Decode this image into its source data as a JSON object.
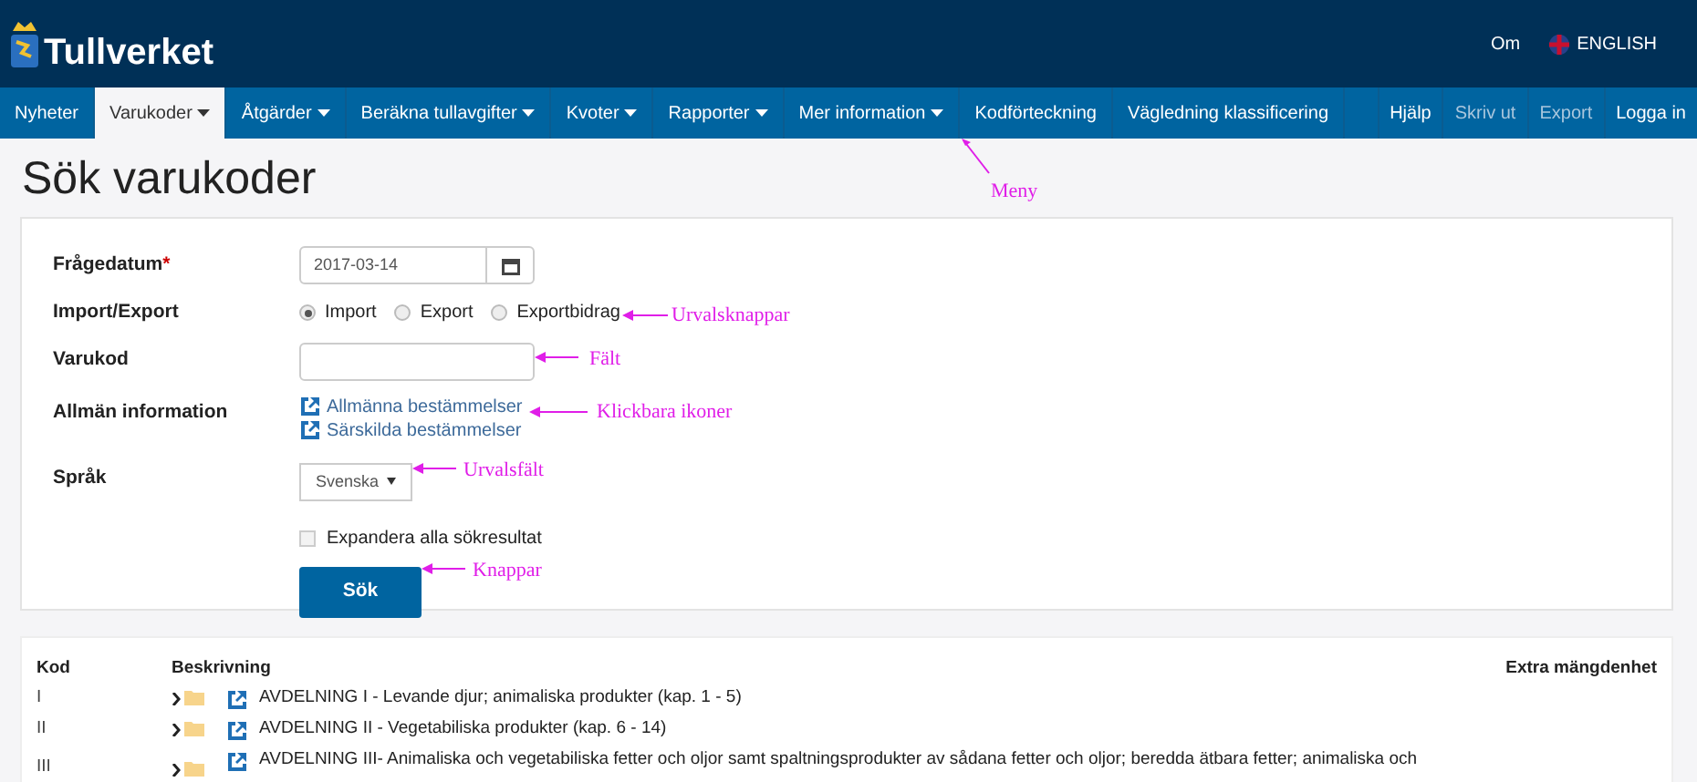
{
  "header": {
    "logo_text": "Tullverket",
    "links": [
      {
        "label": "Om",
        "kind": "plain"
      },
      {
        "label": "ENGLISH",
        "kind": "flag"
      }
    ]
  },
  "nav": {
    "left": [
      {
        "label": "Nyheter",
        "caret": false,
        "selected": false
      },
      {
        "label": "Varukoder",
        "caret": true,
        "selected": true
      },
      {
        "label": "Åtgärder",
        "caret": true,
        "selected": false
      },
      {
        "label": "Beräkna tullavgifter",
        "caret": true,
        "selected": false
      },
      {
        "label": "Kvoter",
        "caret": true,
        "selected": false
      },
      {
        "label": "Rapporter",
        "caret": true,
        "selected": false
      },
      {
        "label": "Mer information",
        "caret": true,
        "selected": false
      },
      {
        "label": "Kodförteckning",
        "caret": false,
        "selected": false
      },
      {
        "label": "Vägledning klassificering",
        "caret": false,
        "selected": false
      }
    ],
    "right": [
      {
        "label": "Hjälp",
        "disabled": false
      },
      {
        "label": "Skriv ut",
        "disabled": true
      },
      {
        "label": "Export",
        "disabled": true
      },
      {
        "label": "Logga in",
        "disabled": false
      }
    ]
  },
  "page_title": "Sök varukoder",
  "form": {
    "date": {
      "label": "Frågedatum",
      "required_mark": "*",
      "value": "2017-03-14"
    },
    "direction": {
      "label": "Import/Export",
      "options": [
        {
          "label": "Import",
          "selected": true
        },
        {
          "label": "Export",
          "selected": false
        },
        {
          "label": "Exportbidrag",
          "selected": false
        }
      ]
    },
    "code": {
      "label": "Varukod"
    },
    "info": {
      "label": "Allmän information",
      "links": [
        "Allmänna bestämmelser",
        "Särskilda bestämmelser"
      ]
    },
    "language": {
      "label": "Språk",
      "value": "Svenska"
    },
    "expand": {
      "label": "Expandera alla sökresultat",
      "checked": false
    },
    "submit": "Sök"
  },
  "table": {
    "columns": [
      "Kod",
      "Beskrivning",
      "Extra mängdenhet"
    ],
    "rows": [
      {
        "code": "I",
        "description": "AVDELNING I - Levande djur; animaliska produkter (kap. 1 - 5)"
      },
      {
        "code": "II",
        "description": "AVDELNING II - Vegetabiliska produkter (kap. 6 - 14)"
      },
      {
        "code": "III",
        "description": "AVDELNING III- Animaliska och vegetabiliska fetter och oljor samt spaltningsprodukter av sådana fetter och oljor; beredda ätbara fetter; animaliska och"
      }
    ]
  },
  "annotations": [
    "Meny",
    "Urvalsknappar",
    "Fält",
    "Klickbara ikoner",
    "Urvalsfält",
    "Knappar"
  ]
}
